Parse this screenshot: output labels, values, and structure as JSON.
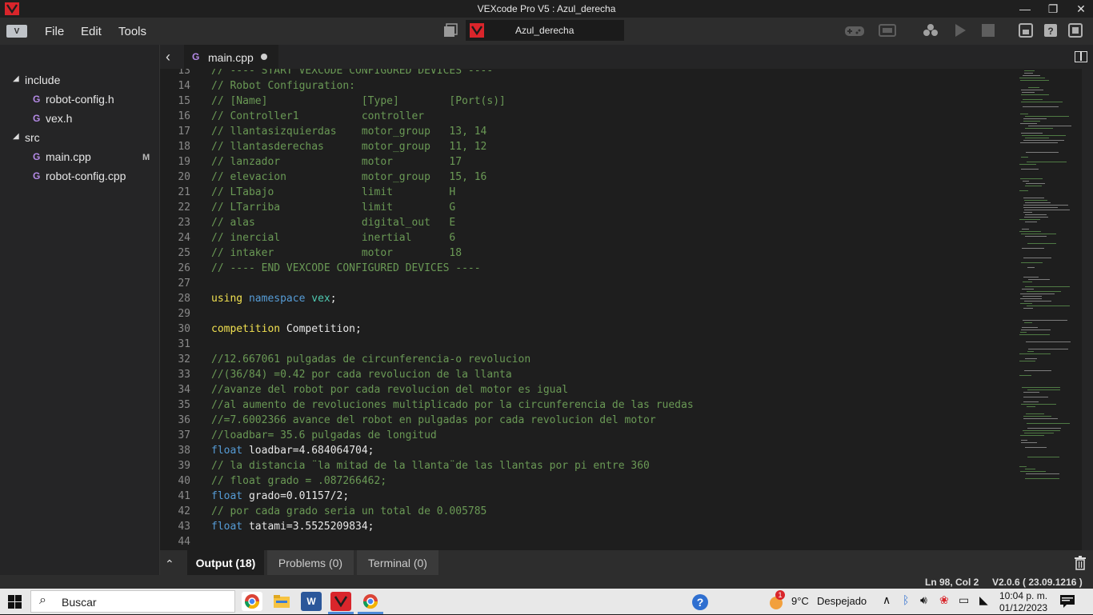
{
  "window": {
    "title": "VEXcode Pro V5 : Azul_derecha"
  },
  "menu": {
    "items": [
      "File",
      "Edit",
      "Tools"
    ]
  },
  "project": {
    "name": "Azul_derecha"
  },
  "explorer": {
    "folders": [
      {
        "name": "include",
        "files": [
          {
            "name": "robot-config.h",
            "modified": ""
          },
          {
            "name": "vex.h",
            "modified": ""
          }
        ]
      },
      {
        "name": "src",
        "files": [
          {
            "name": "main.cpp",
            "modified": "M"
          },
          {
            "name": "robot-config.cpp",
            "modified": ""
          }
        ]
      }
    ]
  },
  "editor": {
    "tab_label": "main.cpp",
    "lines": [
      {
        "n": "13",
        "segments": [
          {
            "t": "// ---- START VEXCODE CONFIGURED DEVICES ----",
            "c": "comment"
          }
        ]
      },
      {
        "n": "14",
        "segments": [
          {
            "t": "// Robot Configuration:",
            "c": "comment"
          }
        ]
      },
      {
        "n": "15",
        "segments": [
          {
            "t": "// [Name]               [Type]        [Port(s)]",
            "c": "comment"
          }
        ]
      },
      {
        "n": "16",
        "segments": [
          {
            "t": "// Controller1          controller",
            "c": "comment"
          }
        ]
      },
      {
        "n": "17",
        "segments": [
          {
            "t": "// llantasizquierdas    motor_group   13, 14",
            "c": "comment"
          }
        ]
      },
      {
        "n": "18",
        "segments": [
          {
            "t": "// llantasderechas      motor_group   11, 12",
            "c": "comment"
          }
        ]
      },
      {
        "n": "19",
        "segments": [
          {
            "t": "// lanzador             motor         17",
            "c": "comment"
          }
        ]
      },
      {
        "n": "20",
        "segments": [
          {
            "t": "// elevacion            motor_group   15, 16",
            "c": "comment"
          }
        ]
      },
      {
        "n": "21",
        "segments": [
          {
            "t": "// LTabajo              limit         H",
            "c": "comment"
          }
        ]
      },
      {
        "n": "22",
        "segments": [
          {
            "t": "// LTarriba             limit         G",
            "c": "comment"
          }
        ]
      },
      {
        "n": "23",
        "segments": [
          {
            "t": "// alas                 digital_out   E",
            "c": "comment"
          }
        ]
      },
      {
        "n": "24",
        "segments": [
          {
            "t": "// inercial             inertial      6",
            "c": "comment"
          }
        ]
      },
      {
        "n": "25",
        "segments": [
          {
            "t": "// intaker              motor         18",
            "c": "comment"
          }
        ]
      },
      {
        "n": "26",
        "segments": [
          {
            "t": "// ---- END VEXCODE CONFIGURED DEVICES ----",
            "c": "comment"
          }
        ]
      },
      {
        "n": "27",
        "segments": []
      },
      {
        "n": "28",
        "segments": [
          {
            "t": "using",
            "c": "comp"
          },
          {
            "t": " ",
            "c": "plain"
          },
          {
            "t": "namespace",
            "c": "kw"
          },
          {
            "t": " ",
            "c": "plain"
          },
          {
            "t": "vex",
            "c": "type"
          },
          {
            "t": ";",
            "c": "plain"
          }
        ]
      },
      {
        "n": "29",
        "segments": []
      },
      {
        "n": "30",
        "segments": [
          {
            "t": "competition",
            "c": "comp"
          },
          {
            "t": " Competition;",
            "c": "plain"
          }
        ]
      },
      {
        "n": "31",
        "segments": []
      },
      {
        "n": "32",
        "segments": [
          {
            "t": "//12.667061 pulgadas de circunferencia-o revolucion",
            "c": "comment"
          }
        ]
      },
      {
        "n": "33",
        "segments": [
          {
            "t": "//(36/84) =0.42 por cada revolucion de la llanta",
            "c": "comment"
          }
        ]
      },
      {
        "n": "34",
        "segments": [
          {
            "t": "//avanze del robot por cada revolucion del motor es igual",
            "c": "comment"
          }
        ]
      },
      {
        "n": "35",
        "segments": [
          {
            "t": "//al aumento de revoluciones multiplicado por la circunferencia de las ruedas",
            "c": "comment"
          }
        ]
      },
      {
        "n": "36",
        "segments": [
          {
            "t": "//=7.6002366 avance del robot en pulgadas por cada revolucion del motor",
            "c": "comment"
          }
        ]
      },
      {
        "n": "37",
        "segments": [
          {
            "t": "//loadbar= 35.6 pulgadas de longitud",
            "c": "comment"
          }
        ]
      },
      {
        "n": "38",
        "segments": [
          {
            "t": "float",
            "c": "kw"
          },
          {
            "t": " loadbar=4.684064704;",
            "c": "plain"
          }
        ]
      },
      {
        "n": "39",
        "segments": [
          {
            "t": "// la distancia ¨la mitad de la llanta¨de las llantas por pi entre 360",
            "c": "comment"
          }
        ]
      },
      {
        "n": "40",
        "segments": [
          {
            "t": "// float grado = .087266462;",
            "c": "comment"
          }
        ]
      },
      {
        "n": "41",
        "segments": [
          {
            "t": "float",
            "c": "kw"
          },
          {
            "t": " grado=0.01157/2;",
            "c": "plain"
          }
        ]
      },
      {
        "n": "42",
        "segments": [
          {
            "t": "// por cada grado seria un total de 0.005785",
            "c": "comment"
          }
        ]
      },
      {
        "n": "43",
        "segments": [
          {
            "t": "float",
            "c": "kw"
          },
          {
            "t": " tatami=3.5525209834;",
            "c": "plain"
          }
        ]
      },
      {
        "n": "44",
        "segments": []
      }
    ]
  },
  "panel": {
    "tabs": [
      "Output (18)",
      "Problems (0)",
      "Terminal (0)"
    ],
    "active": "Output (18)"
  },
  "status": {
    "cursor": "Ln 98, Col 2",
    "version": "V2.0.6 ( 23.09.1216 )"
  },
  "taskbar": {
    "search_label": "Buscar",
    "weather_temp": "9°C",
    "weather_desc": "Despejado",
    "weather_badge": "1",
    "time": "10:04 p. m.",
    "date": "01/12/2023"
  },
  "colors": {
    "accent_red": "#d9252b",
    "comment": "#6a9955",
    "keyword": "#569cd6"
  }
}
